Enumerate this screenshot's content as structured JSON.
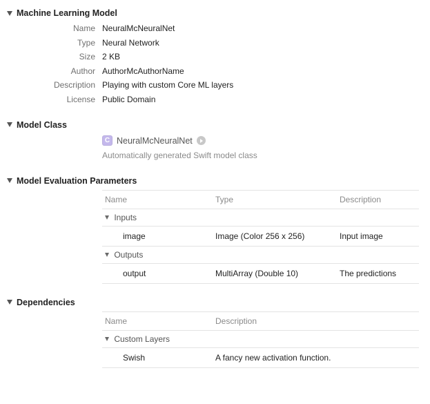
{
  "ml": {
    "title": "Machine Learning Model",
    "rows": {
      "name_label": "Name",
      "name": "NeuralMcNeuralNet",
      "type_label": "Type",
      "type": "Neural Network",
      "size_label": "Size",
      "size": "2 KB",
      "author_label": "Author",
      "author": "AuthorMcAuthorName",
      "desc_label": "Description",
      "desc": "Playing with custom Core ML layers",
      "license_label": "License",
      "license": "Public Domain"
    }
  },
  "cls": {
    "title": "Model Class",
    "badge": "C",
    "name": "NeuralMcNeuralNet",
    "caption": "Automatically generated Swift model class"
  },
  "eval": {
    "title": "Model Evaluation Parameters",
    "head": {
      "name": "Name",
      "type": "Type",
      "desc": "Description"
    },
    "inputs_label": "Inputs",
    "outputs_label": "Outputs",
    "input": {
      "name": "image",
      "type": "Image (Color 256 x 256)",
      "desc": "Input image"
    },
    "output": {
      "name": "output",
      "type": "MultiArray (Double 10)",
      "desc": "The predictions"
    }
  },
  "deps": {
    "title": "Dependencies",
    "head": {
      "name": "Name",
      "desc": "Description"
    },
    "group_label": "Custom Layers",
    "row": {
      "name": "Swish",
      "desc": "A fancy new activation function."
    }
  }
}
